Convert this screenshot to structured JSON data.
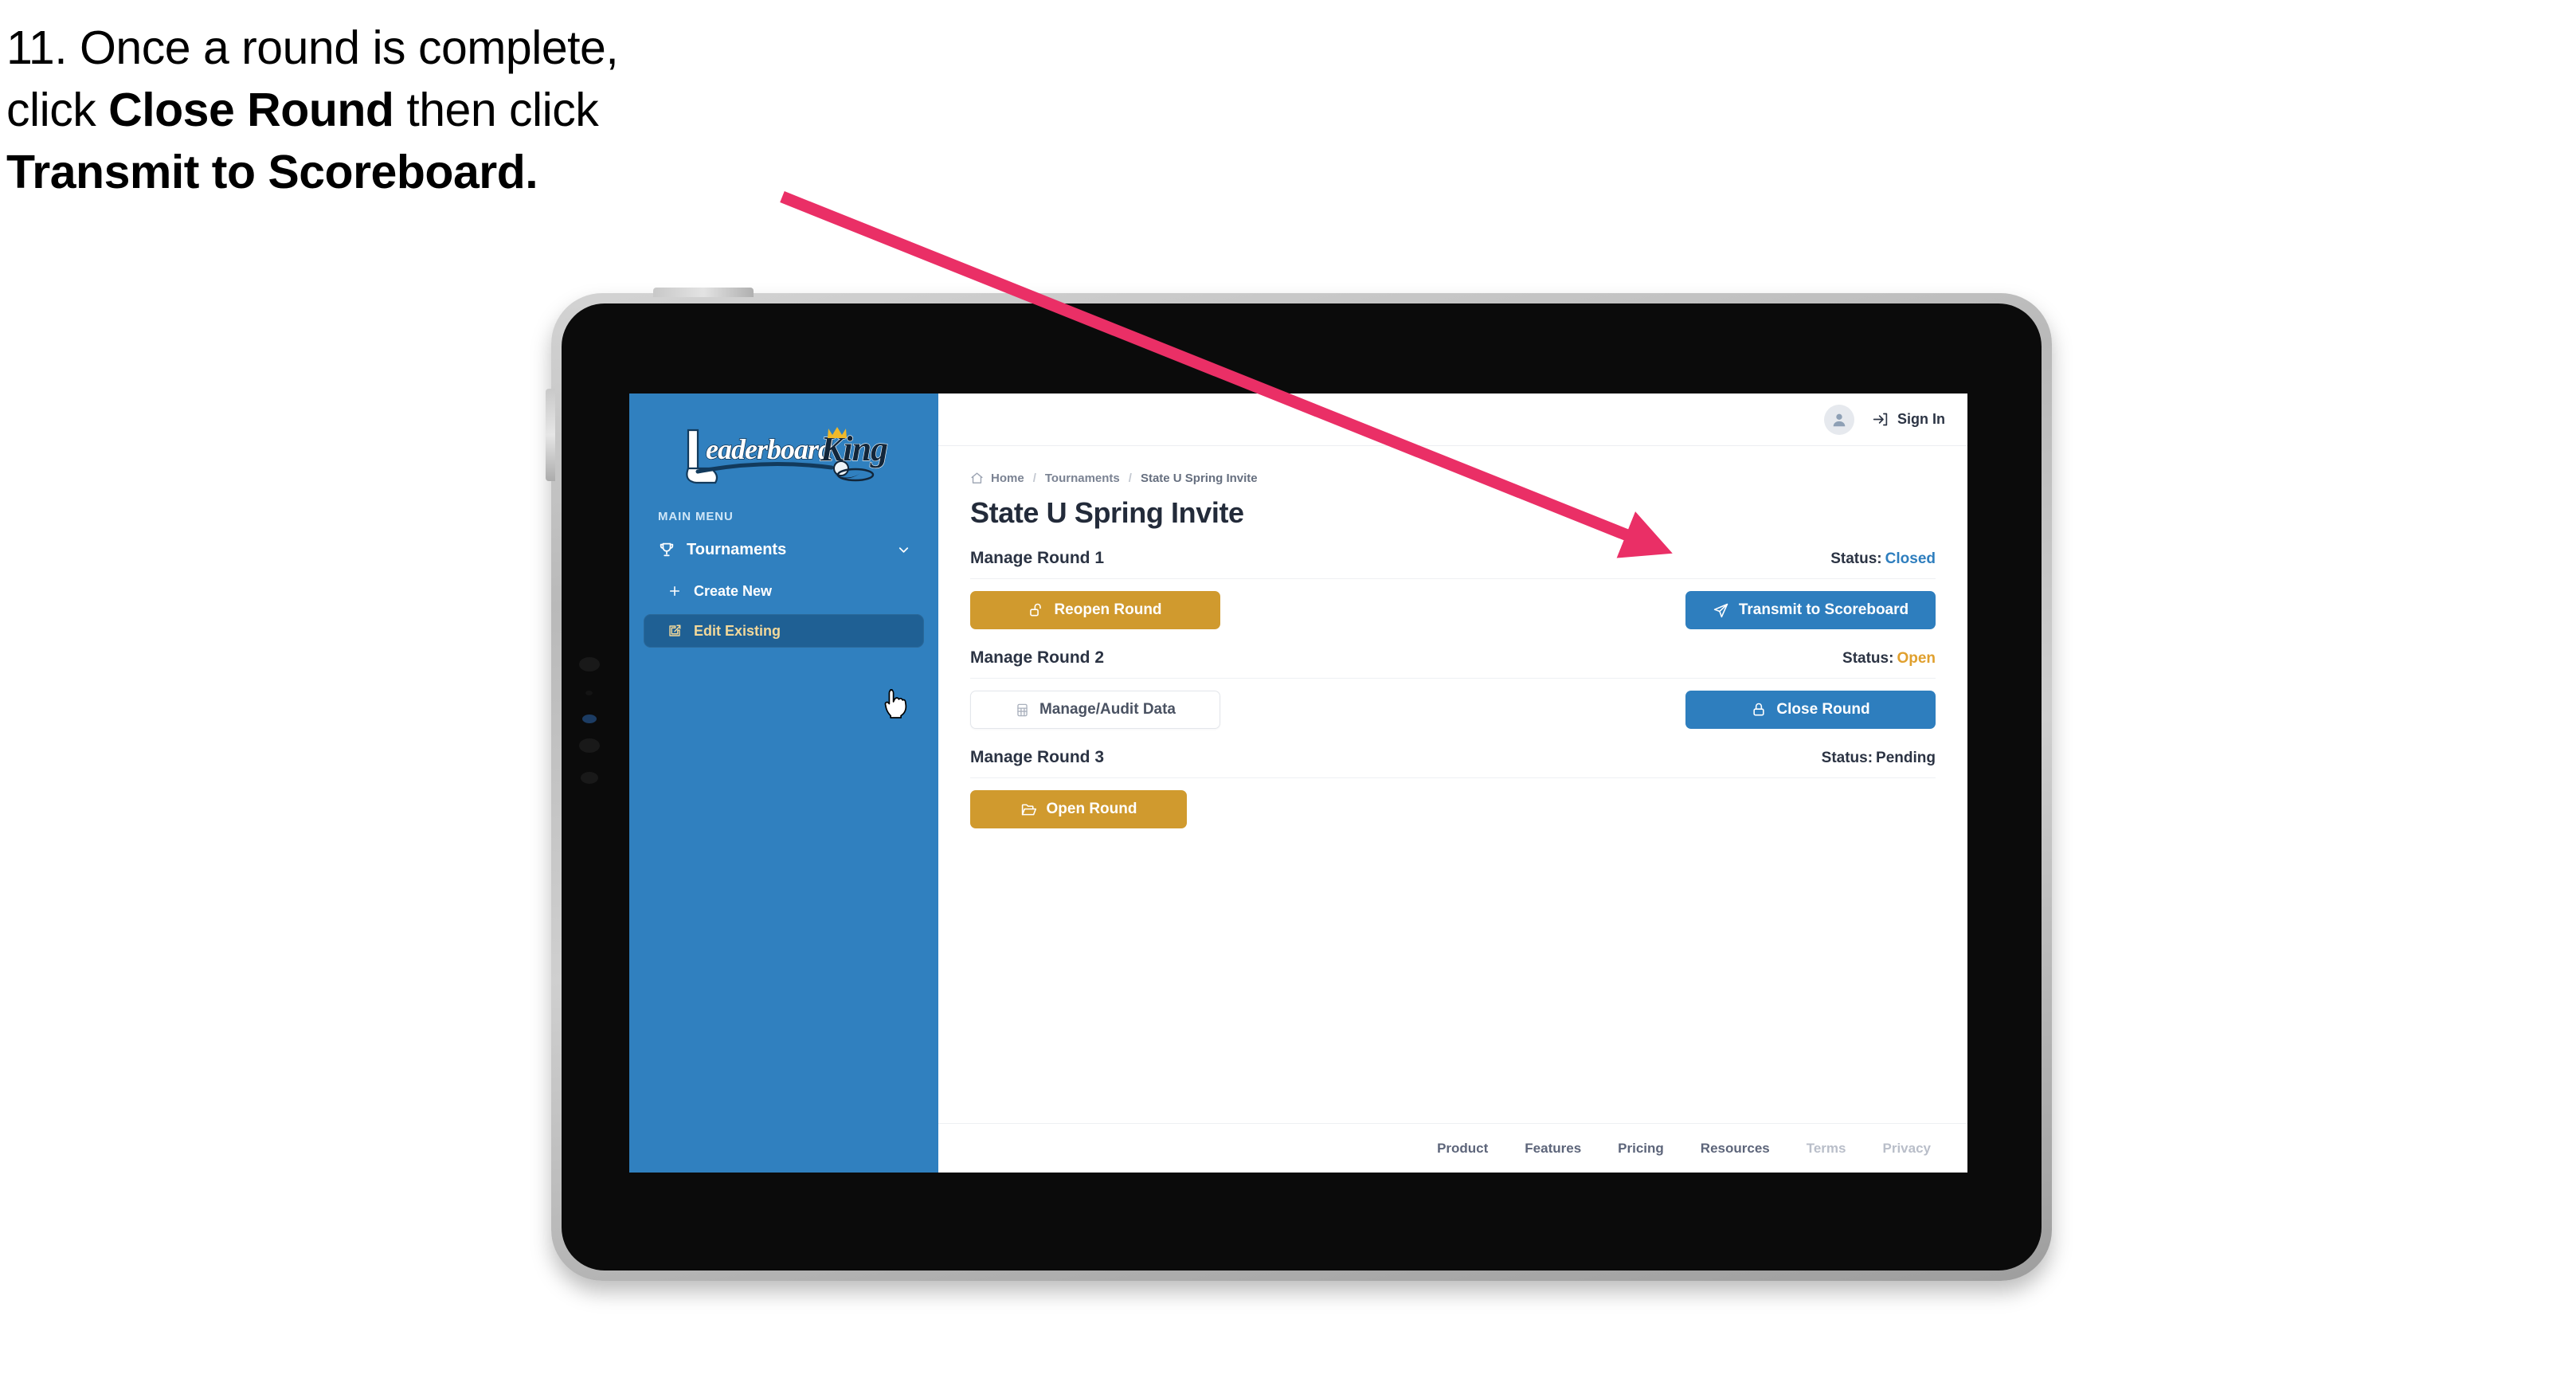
{
  "caption": {
    "line1_plain": "11. Once a round is complete,",
    "line2_pre": "click ",
    "line2_bold": "Close Round",
    "line2_post": " then click",
    "line3_bold": "Transmit to Scoreboard."
  },
  "annotation": {
    "arrow_color": "#ea2f66",
    "arrow_points_to": "Transmit to Scoreboard"
  },
  "device": {
    "type": "tablet",
    "frame_color": "#c6c6c6",
    "bezel_color": "#0b0b0b"
  },
  "sidebar": {
    "brand": {
      "name": "LeaderboardKing",
      "word1": "Leaderboard",
      "word2": "King",
      "icon": "golf-club-crown-logo"
    },
    "background_color": "#3080bf",
    "section_label": "MAIN MENU",
    "items": [
      {
        "label": "Tournaments",
        "icon": "trophy-icon",
        "trailing_icon": "chevron-down-icon",
        "active": false
      },
      {
        "label": "Create New",
        "icon": "plus-icon",
        "active": false
      },
      {
        "label": "Edit Existing",
        "icon": "pencil-square-icon",
        "active": true,
        "active_bg": "#1f6094",
        "active_text_color": "#f2d89a"
      }
    ],
    "cursor": "hand-pointer-cursor"
  },
  "topbar": {
    "avatar_icon": "user-avatar-icon",
    "signin_icon": "sign-in-arrow-icon",
    "signin_label": "Sign In"
  },
  "breadcrumb": {
    "home_icon": "home-icon",
    "items": [
      "Home",
      "Tournaments",
      "State U Spring Invite"
    ],
    "separator": "/"
  },
  "page": {
    "title": "State U Spring Invite"
  },
  "rounds": [
    {
      "name": "Manage Round 1",
      "status_label": "Status:",
      "status_value": "Closed",
      "status_color": "#2e7ebe",
      "left_button": {
        "label": "Reopen Round",
        "icon": "unlock-icon",
        "style": "gold",
        "color": "#d09a2e"
      },
      "right_button": {
        "label": "Transmit to Scoreboard",
        "icon": "paper-plane-icon",
        "style": "blue",
        "color": "#2e7ebe"
      }
    },
    {
      "name": "Manage Round 2",
      "status_label": "Status:",
      "status_value": "Open",
      "status_color": "#e0a02e",
      "left_button": {
        "label": "Manage/Audit Data",
        "icon": "spreadsheet-icon",
        "style": "ghost",
        "color": "#ffffff"
      },
      "right_button": {
        "label": "Close Round",
        "icon": "lock-icon",
        "style": "blue",
        "color": "#2e7ebe"
      }
    },
    {
      "name": "Manage Round 3",
      "status_label": "Status:",
      "status_value": "Pending",
      "status_color": "#2b3343",
      "left_button": {
        "label": "Open Round",
        "icon": "open-folder-icon",
        "style": "gold",
        "color": "#d09a2e"
      },
      "right_button": null
    }
  ],
  "footer": {
    "links": [
      {
        "label": "Product",
        "muted": false
      },
      {
        "label": "Features",
        "muted": false
      },
      {
        "label": "Pricing",
        "muted": false
      },
      {
        "label": "Resources",
        "muted": false
      },
      {
        "label": "Terms",
        "muted": true
      },
      {
        "label": "Privacy",
        "muted": true
      }
    ]
  }
}
